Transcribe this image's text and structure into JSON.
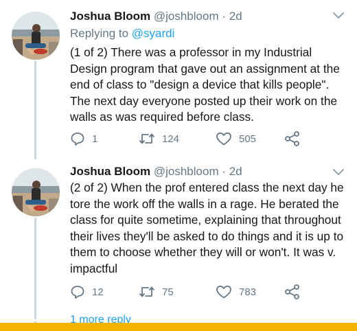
{
  "thread": [
    {
      "author_name": "Joshua Bloom",
      "author_handle": "@joshbloom",
      "separator": "·",
      "time": "2d",
      "replying_prefix": "Replying to",
      "replying_to": "@syardi",
      "text": "(1 of 2) There was a professor in my Industrial Design program that gave out an assignment at the end of class to \"design a device that kills people\". The next day everyone posted up their work on the walls as was required before class.",
      "reply_count": "1",
      "retweet_count": "124",
      "like_count": "505"
    },
    {
      "author_name": "Joshua Bloom",
      "author_handle": "@joshbloom",
      "separator": "·",
      "time": "2d",
      "text": "(2 of 2) When the prof entered class the next day he tore the work off the walls in a rage. He berated the class for quite sometime, explaining that throughout their lives they'll be asked to do things and it is up to them to choose whether they will or won't. It was v. impactful",
      "reply_count": "12",
      "retweet_count": "75",
      "like_count": "783"
    }
  ],
  "more_replies": "1 more reply",
  "colors": {
    "link": "#1da1f2",
    "secondary_text": "#657786",
    "thread_line": "#ccd6dd",
    "bottom_bar": "#f4b400"
  },
  "icons": [
    "chevron-down-icon",
    "reply-icon",
    "retweet-icon",
    "like-icon",
    "share-icon"
  ]
}
